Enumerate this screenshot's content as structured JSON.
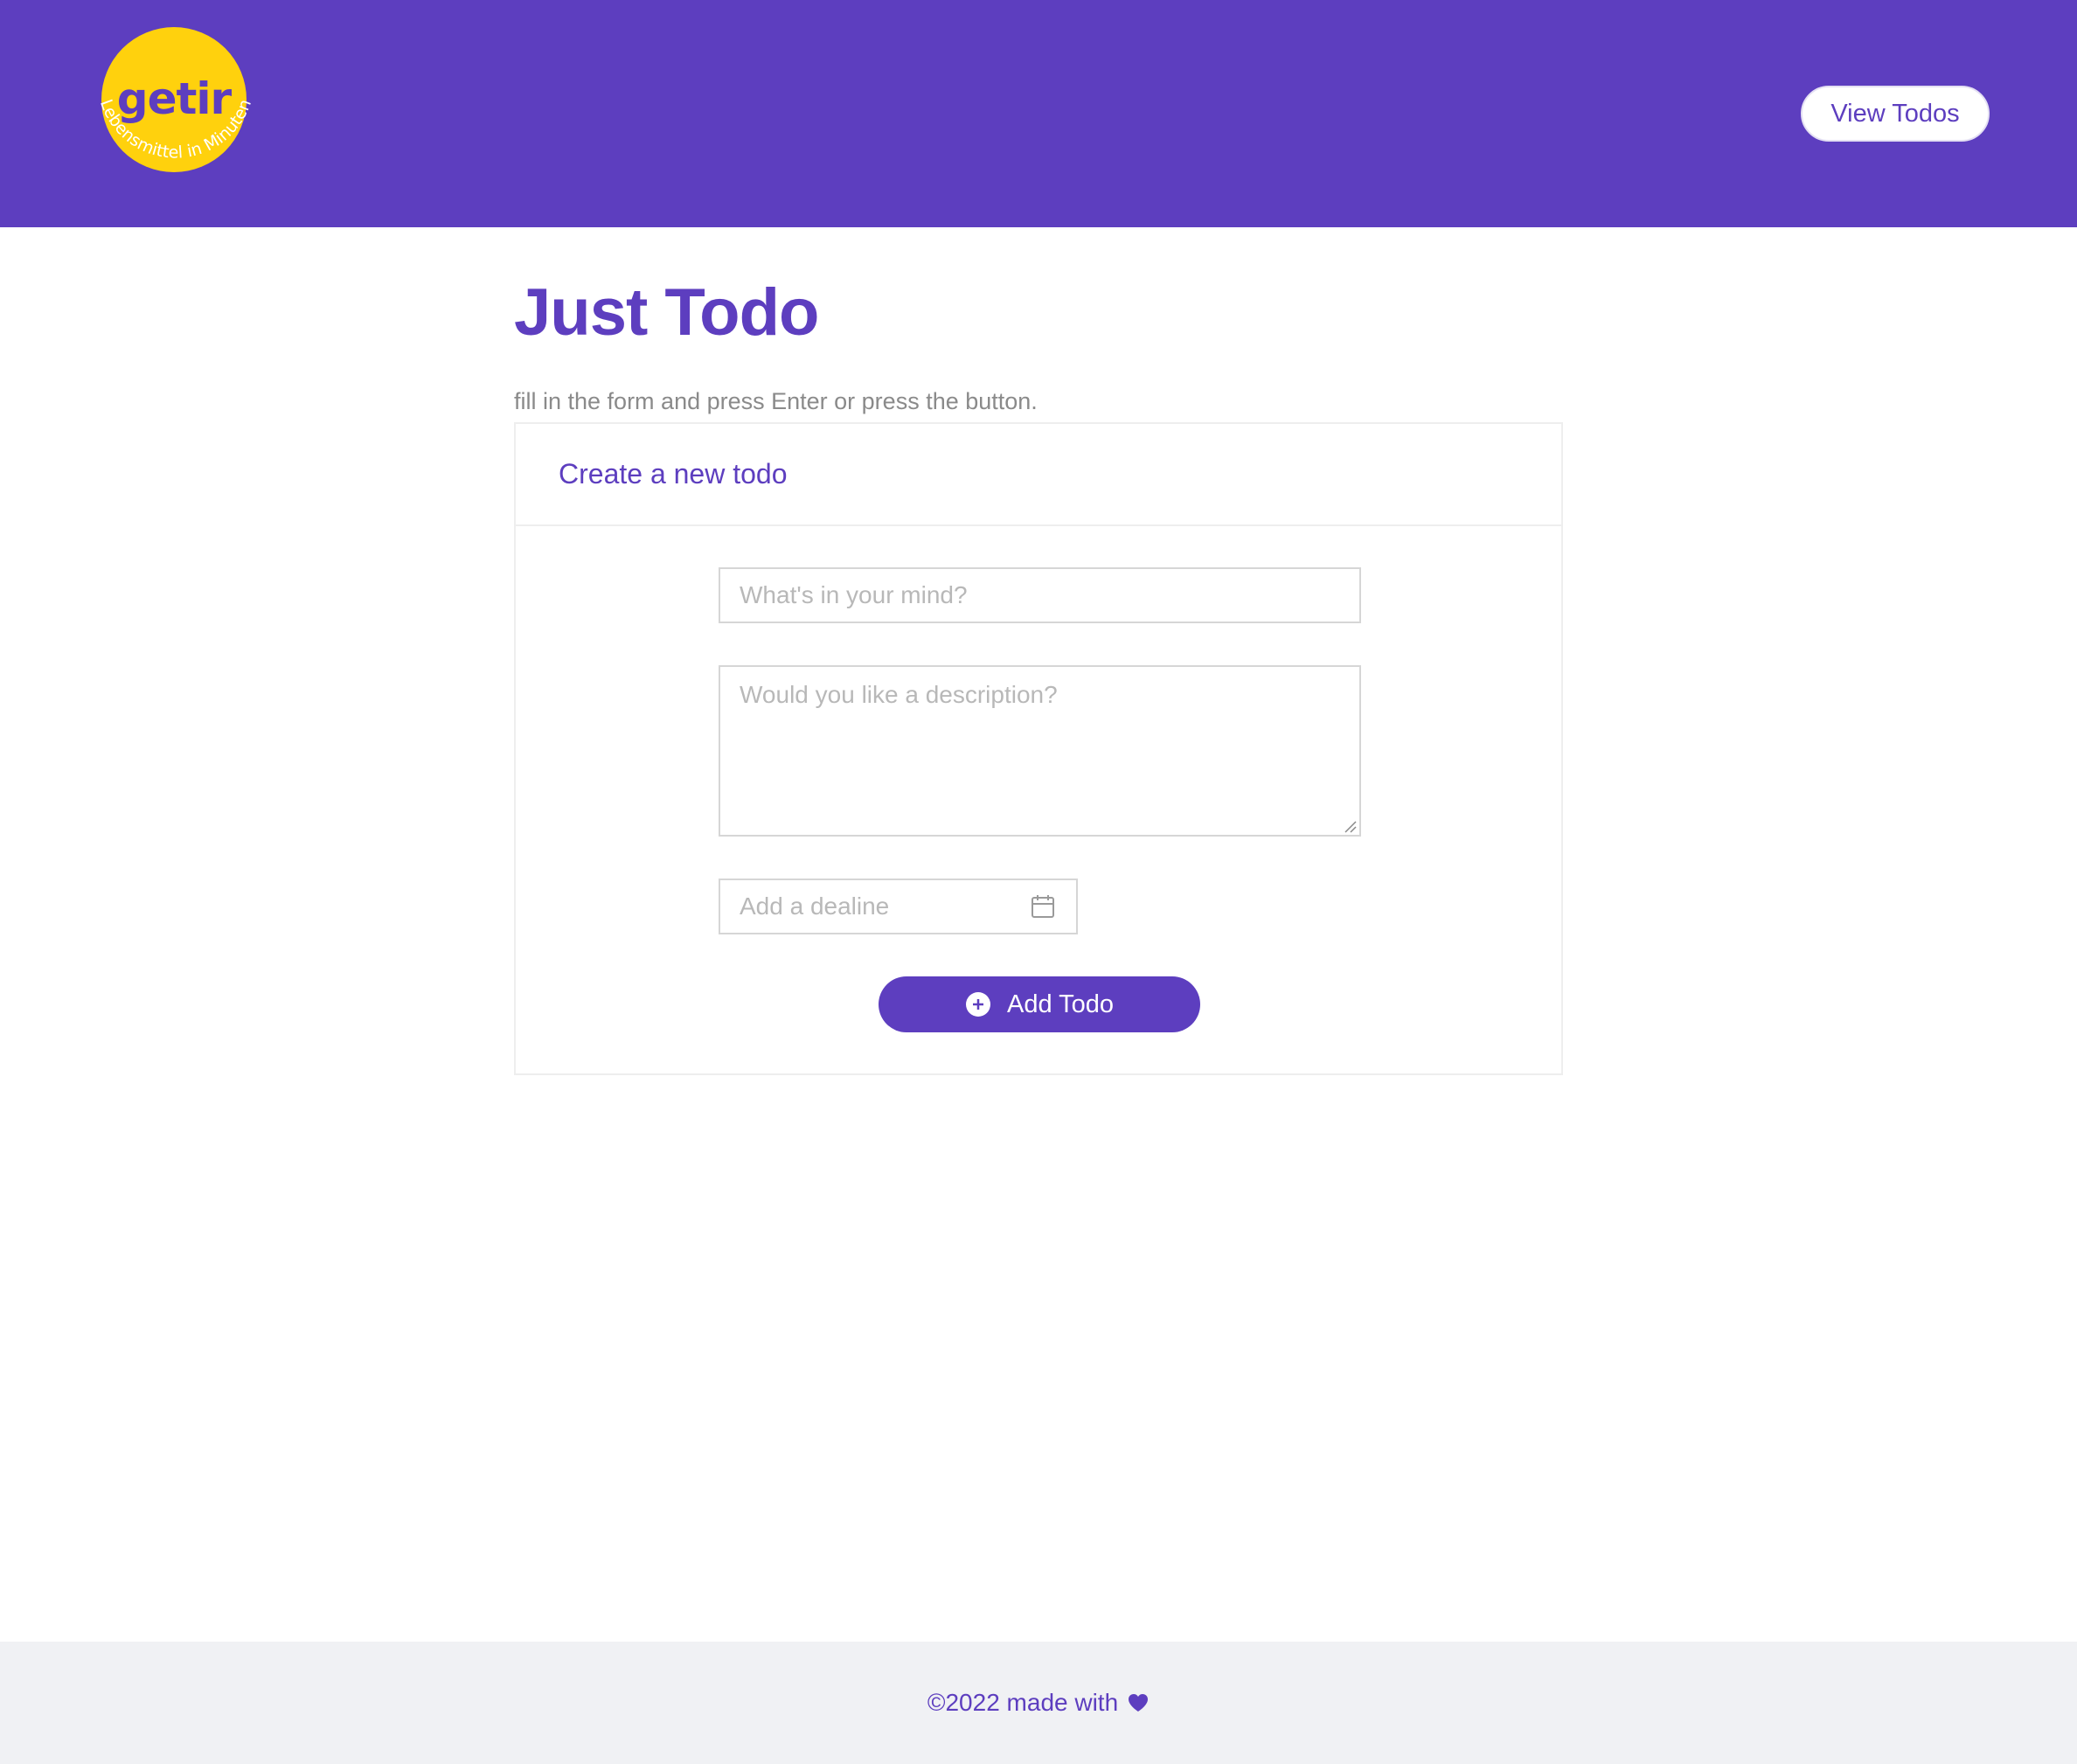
{
  "header": {
    "logo": {
      "wordmark": "getir",
      "tagline": "Lebensmittel in Minuten"
    },
    "view_todos_label": "View Todos"
  },
  "main": {
    "title": "Just Todo",
    "subtitle": "fill in the form and press Enter or press the button."
  },
  "form": {
    "card_title": "Create a new todo",
    "title_placeholder": "What's in your mind?",
    "description_placeholder": "Would you like a description?",
    "deadline_placeholder": "Add a dealine",
    "submit_label": "Add Todo"
  },
  "footer": {
    "text": "©2022 made with"
  },
  "icons": {
    "calendar": "calendar-icon",
    "plus": "plus-circle-icon",
    "heart": "heart-icon"
  },
  "colors": {
    "brand_purple": "#5d3ebf",
    "brand_yellow": "#ffd10d",
    "footer_bg": "#f0f1f4"
  }
}
